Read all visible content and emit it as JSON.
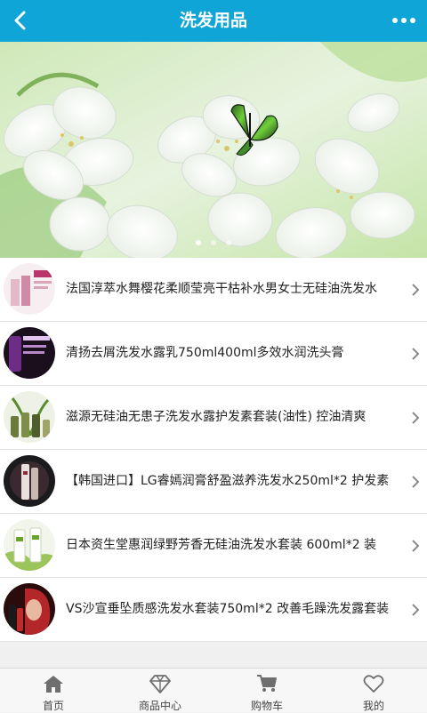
{
  "header": {
    "title": "洗发用品",
    "back_icon": "chevron-left-icon",
    "more_icon": "more-dots-icon"
  },
  "banner": {
    "slide_count": 3,
    "active_slide": 1
  },
  "products": [
    {
      "name": "法国淳萃水舞樱花柔顺莹亮干枯补水男女士无硅油洗发水"
    },
    {
      "name": "清扬去屑洗发水露乳750ml400ml多效水润洗头膏"
    },
    {
      "name": "滋源无硅油无患子洗发水露护发素套装(油性) 控油清爽"
    },
    {
      "name": "【韩国进口】LG睿嫣润膏舒盈滋养洗发水250ml*2 护发素"
    },
    {
      "name": "日本资生堂惠润绿野芳香无硅油洗发水套装 600ml*2 装"
    },
    {
      "name": "VS沙宣垂坠质感洗发水套装750ml*2 改善毛躁洗发露套装"
    }
  ],
  "tabbar": [
    {
      "label": "首页",
      "icon": "home-icon"
    },
    {
      "label": "商品中心",
      "icon": "diamond-icon"
    },
    {
      "label": "购物车",
      "icon": "cart-icon"
    },
    {
      "label": "我的",
      "icon": "heart-icon"
    }
  ],
  "colors": {
    "header_bg": "#0fa5d6",
    "text": "#222222",
    "tab_icon": "#6e6e6e"
  }
}
